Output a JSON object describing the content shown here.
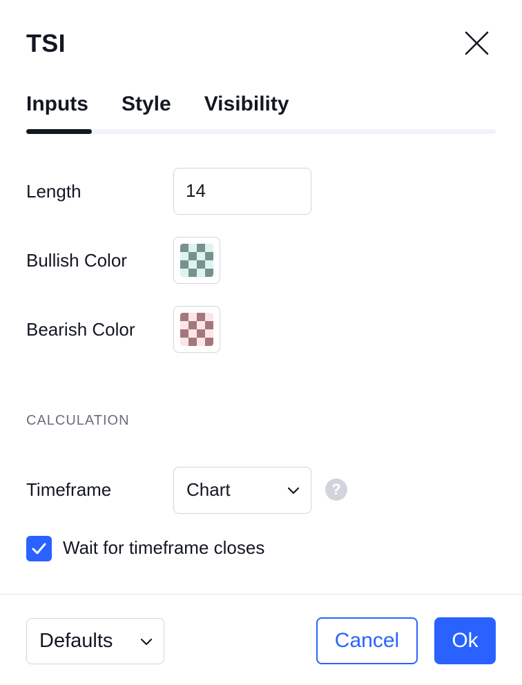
{
  "dialog": {
    "title": "TSI",
    "close_icon": "close-icon"
  },
  "tabs": [
    {
      "label": "Inputs",
      "active": true
    },
    {
      "label": "Style",
      "active": false
    },
    {
      "label": "Visibility",
      "active": false
    }
  ],
  "inputs": {
    "length_label": "Length",
    "length_value": "14",
    "bullish_label": "Bullish Color",
    "bullish_color": "#26a69a",
    "bearish_label": "Bearish Color",
    "bearish_color": "#ef5350"
  },
  "calculation": {
    "section_title": "CALCULATION",
    "timeframe_label": "Timeframe",
    "timeframe_value": "Chart",
    "help_glyph": "?",
    "wait_label": "Wait for timeframe closes",
    "wait_checked": true
  },
  "footer": {
    "defaults_label": "Defaults",
    "cancel_label": "Cancel",
    "ok_label": "Ok"
  },
  "colors": {
    "accent": "#2962ff",
    "text": "#131722",
    "muted": "#6a6d78",
    "border": "#d1d4dc"
  }
}
